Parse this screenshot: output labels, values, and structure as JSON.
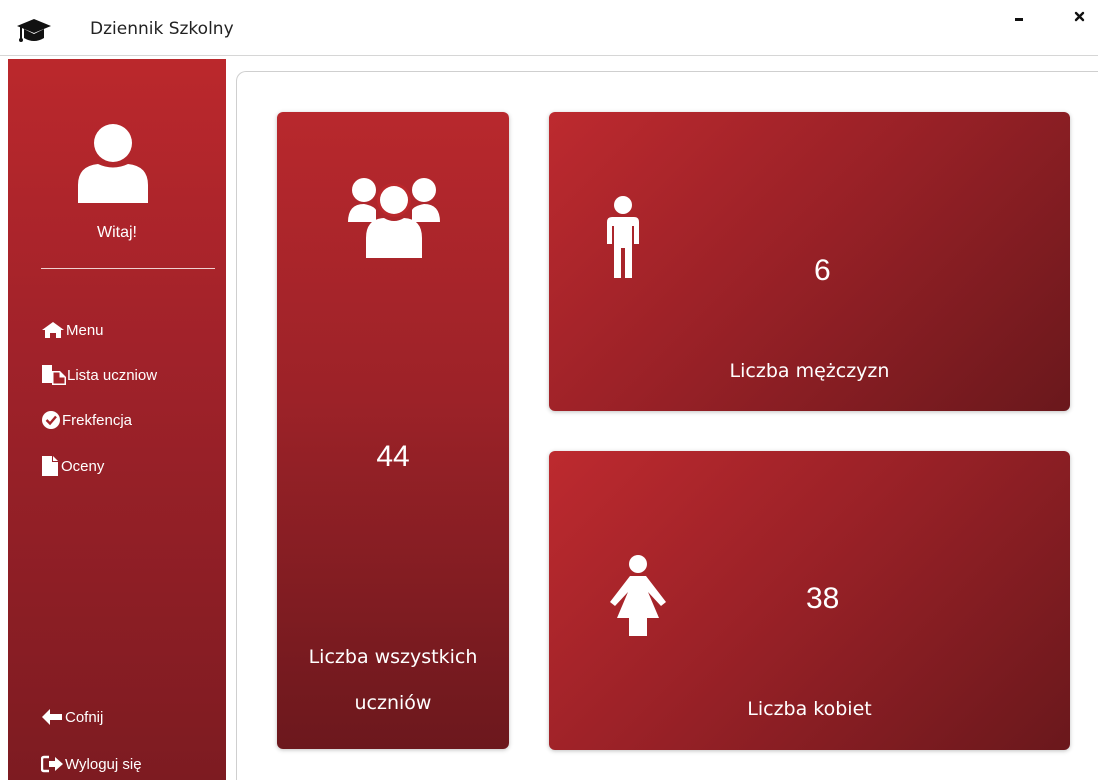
{
  "window": {
    "title": "Dziennik Szkolny",
    "icon": "graduation-cap-icon",
    "controls": [
      "minimize-icon",
      "close-icon"
    ]
  },
  "sidebar": {
    "avatar_icon": "user-icon",
    "greeting": "Witaj!",
    "items": [
      {
        "label": "Menu",
        "icon": "home-icon"
      },
      {
        "label": "Lista uczniow",
        "icon": "copy-icon"
      },
      {
        "label": "Frekfencja",
        "icon": "check-circle-icon"
      },
      {
        "label": "Oceny",
        "icon": "file-icon"
      }
    ],
    "bottom_items": [
      {
        "label": "Cofnij",
        "icon": "arrow-left-icon"
      },
      {
        "label": "Wyloguj się",
        "icon": "sign-out-icon"
      }
    ]
  },
  "stats": {
    "total": {
      "value": "44",
      "label_line1": "Liczba wszystkich",
      "label_line2": "uczniów",
      "icon": "users-icon"
    },
    "men": {
      "value": "6",
      "label": "Liczba mężczyzn",
      "icon": "male-icon"
    },
    "women": {
      "value": "38",
      "label": "Liczba kobiet",
      "icon": "female-icon"
    }
  },
  "colors": {
    "accent_red": "#bb282c",
    "dark_red": "#6a181c",
    "text_on_accent": "#ffffff"
  }
}
